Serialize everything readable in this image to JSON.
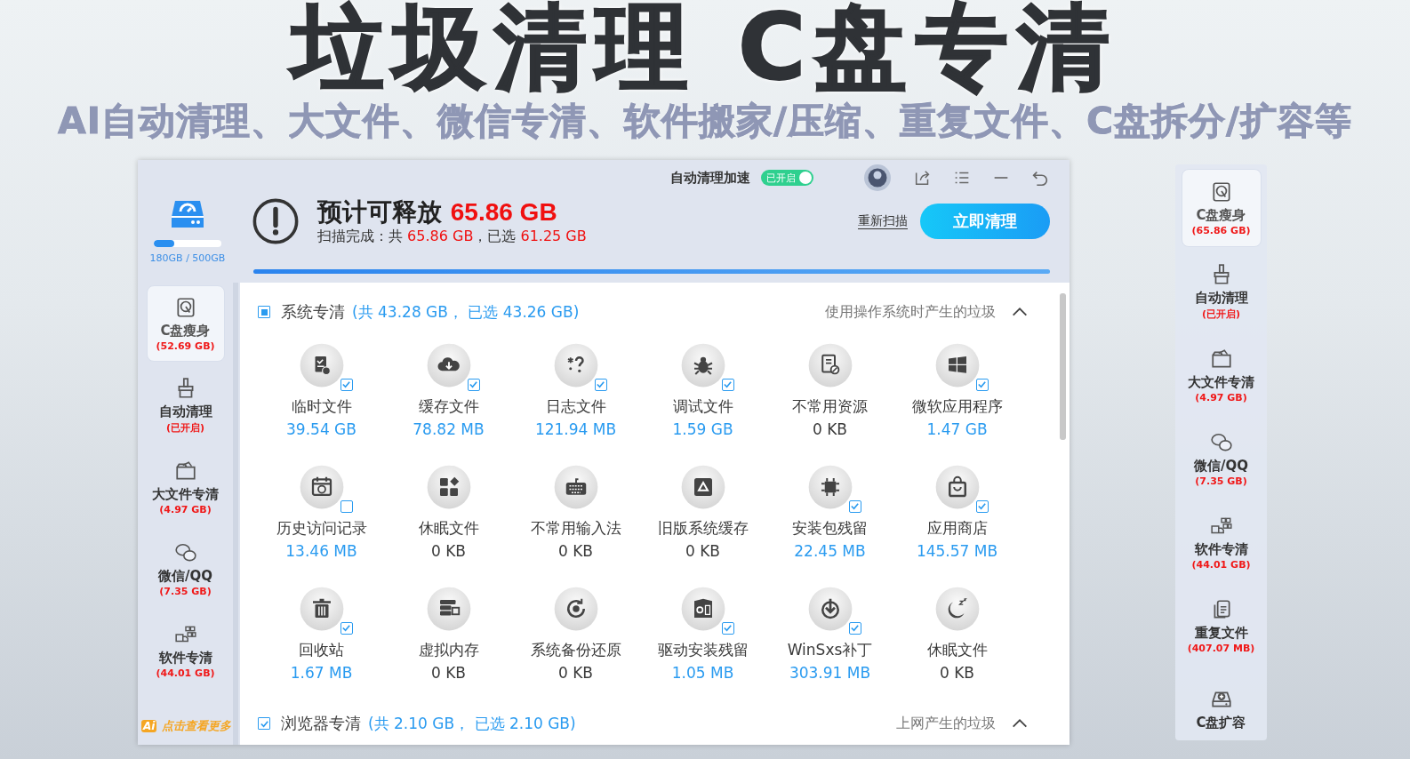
{
  "banner": {
    "title": "垃圾清理 C盘专清",
    "subtitle": "AI自动清理、大文件、微信专清、软件搬家/压缩、重复文件、C盘拆分/扩容等"
  },
  "window": {
    "toolbar": {
      "auto_boost_label": "自动清理加速",
      "auto_boost_toggle": {
        "text": "已开启",
        "on": true
      }
    },
    "disk": {
      "usage": "180GB / 500GB",
      "level": 0.3
    },
    "summary": {
      "headline": "预计可释放",
      "amount": "65.86 GB",
      "detail_prefix": "扫描完成：共",
      "total": "65.86 GB",
      "detail_middle": "，已选",
      "selected_size": "61.25 GB"
    },
    "rescan_link": "重新扫描",
    "clean_button": "立即清理",
    "scan_progress": {
      "level": 1
    },
    "sidebar": {
      "items": [
        {
          "title": "C盘瘦身",
          "value": "(52.69 GB)",
          "selected": true
        },
        {
          "title": "自动清理",
          "value": "(已开启)",
          "selected": false
        },
        {
          "title": "大文件专清",
          "value": "(4.97 GB)",
          "selected": false
        },
        {
          "title": "微信/QQ",
          "value": "(7.35 GB)",
          "selected": false
        },
        {
          "title": "软件专清",
          "value": "(44.01 GB)",
          "selected": false
        }
      ],
      "more_badge": "Ai",
      "more_link": "点击查看更多"
    },
    "sections": [
      {
        "title": "系统专清",
        "summary": "(共 43.28 GB， 已选 43.26 GB)",
        "hint": "使用操作系统时产生的垃圾",
        "checked": true,
        "kind": "partial",
        "expanded": true,
        "items": [
          {
            "label": "临时文件",
            "value": "39.54 GB",
            "kind": "check",
            "checked": true,
            "empty": false
          },
          {
            "label": "缓存文件",
            "value": "78.82 MB",
            "kind": "check",
            "checked": true,
            "empty": false
          },
          {
            "label": "日志文件",
            "value": "121.94 MB",
            "kind": "check",
            "checked": true,
            "empty": false
          },
          {
            "label": "调试文件",
            "value": "1.59 GB",
            "kind": "check",
            "checked": true,
            "empty": false
          },
          {
            "label": "不常用资源",
            "value": "0 KB",
            "kind": "plain",
            "empty": true
          },
          {
            "label": "微软应用程序",
            "value": "1.47 GB",
            "kind": "check",
            "checked": true,
            "empty": false
          },
          {
            "label": "历史访问记录",
            "value": "13.46 MB",
            "kind": "check",
            "checked": false,
            "empty": false
          },
          {
            "label": "休眠文件",
            "value": "0 KB",
            "kind": "plain",
            "empty": true
          },
          {
            "label": "不常用输入法",
            "value": "0 KB",
            "kind": "plain",
            "empty": true
          },
          {
            "label": "旧版系统缓存",
            "value": "0 KB",
            "kind": "plain",
            "empty": true
          },
          {
            "label": "安装包残留",
            "value": "22.45 MB",
            "kind": "check",
            "checked": true,
            "empty": false
          },
          {
            "label": "应用商店",
            "value": "145.57 MB",
            "kind": "check",
            "checked": true,
            "empty": false
          },
          {
            "label": "回收站",
            "value": "1.67 MB",
            "kind": "check",
            "checked": true,
            "empty": false
          },
          {
            "label": "虚拟内存",
            "value": "0 KB",
            "kind": "plain",
            "empty": true
          },
          {
            "label": "系统备份还原",
            "value": "0 KB",
            "kind": "plain",
            "empty": true
          },
          {
            "label": "驱动安装残留",
            "value": "1.05 MB",
            "kind": "check",
            "checked": true,
            "empty": false
          },
          {
            "label": "WinSxs补丁",
            "value": "303.91 MB",
            "kind": "check",
            "checked": true,
            "empty": false
          },
          {
            "label": "休眠文件",
            "value": "0 KB",
            "kind": "plain",
            "empty": true
          }
        ]
      },
      {
        "title": "浏览器专清",
        "summary": "(共 2.10 GB， 已选 2.10 GB)",
        "hint": "上网产生的垃圾",
        "checked": true,
        "kind": "full",
        "expanded": true
      }
    ]
  },
  "side_panel": {
    "items": [
      {
        "title": "C盘瘦身",
        "value": "(65.86 GB)",
        "selected": true
      },
      {
        "title": "自动清理",
        "value": "(已开启)",
        "selected": false
      },
      {
        "title": "大文件专清",
        "value": "(4.97 GB)",
        "selected": false
      },
      {
        "title": "微信/QQ",
        "value": "(7.35 GB)",
        "selected": false
      },
      {
        "title": "软件专清",
        "value": "(44.01 GB)",
        "selected": false
      },
      {
        "title": "重复文件",
        "value": "(407.07 MB)",
        "selected": false
      },
      {
        "title": "C盘扩容",
        "selected": false
      }
    ]
  }
}
